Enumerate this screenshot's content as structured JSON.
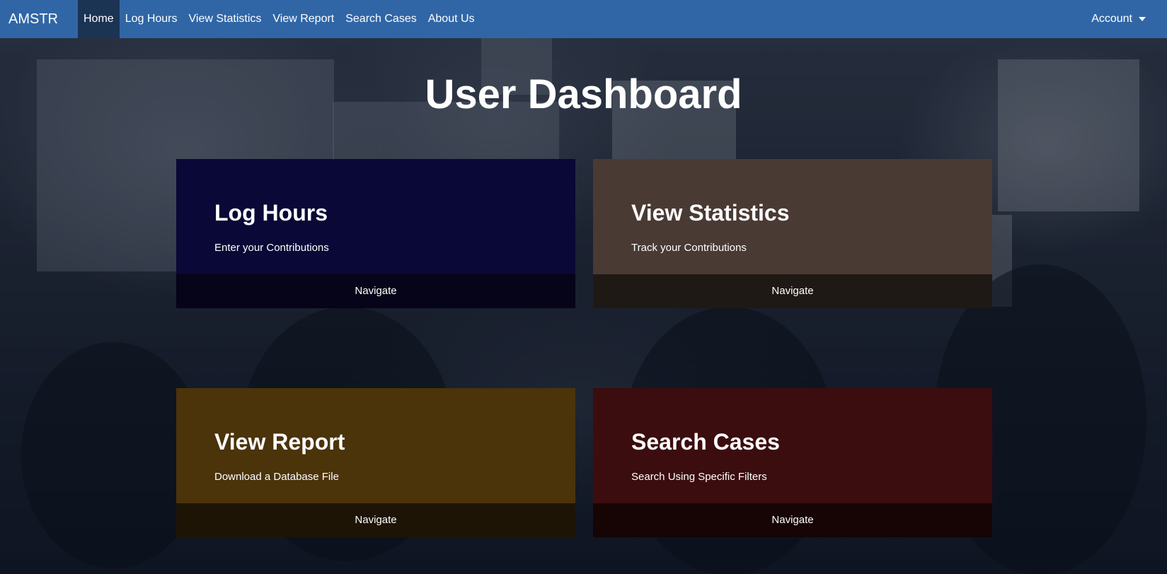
{
  "navbar": {
    "brand": "AMSTR",
    "items": [
      {
        "label": "Home",
        "active": true
      },
      {
        "label": "Log Hours"
      },
      {
        "label": "View Statistics"
      },
      {
        "label": "View Report"
      },
      {
        "label": "Search Cases"
      },
      {
        "label": "About Us"
      }
    ],
    "account_label": "Account",
    "color": "#3066a6",
    "active_color": "#1c3453"
  },
  "main": {
    "title": "User Dashboard",
    "cards": [
      {
        "title": "Log Hours",
        "text": "Enter your Contributions",
        "footer": "Navigate",
        "color": "#090836",
        "footer_color": "#050418"
      },
      {
        "title": "View Statistics",
        "text": "Track your Contributions",
        "footer": "Navigate",
        "color": "#4a3a34",
        "footer_color": "#1f1915"
      },
      {
        "title": "View Report",
        "text": "Download a Database File",
        "footer": "Navigate",
        "color": "#4b330a",
        "footer_color": "#1d1406"
      },
      {
        "title": "Search Cases",
        "text": "Search Using Specific Filters",
        "footer": "Navigate",
        "color": "#3b0d0e",
        "footer_color": "#170405"
      }
    ]
  }
}
